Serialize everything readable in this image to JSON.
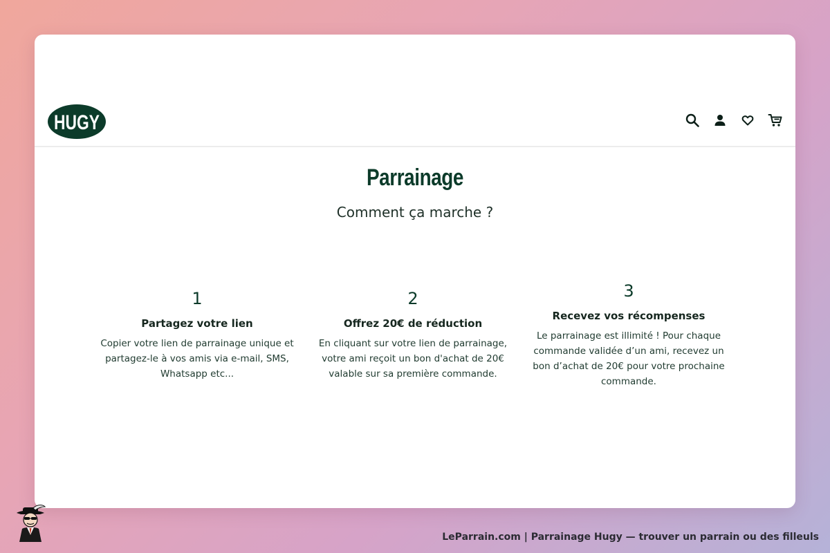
{
  "header": {
    "logo_text": "HUGY",
    "icons": [
      "search-icon",
      "account-icon",
      "wishlist-icon",
      "cart-icon"
    ]
  },
  "main": {
    "title": "Parrainage",
    "subtitle": "Comment ça marche ?",
    "steps": [
      {
        "number": "1",
        "title": "Partagez votre lien",
        "description": "Copier votre lien de parrainage unique et partagez-le à vos amis via e-mail, SMS, Whatsapp etc..."
      },
      {
        "number": "2",
        "title": "Offrez 20€ de réduction",
        "description": "En cliquant sur votre lien de parrainage, votre ami reçoit un bon d'achat de 20€ valable sur sa première commande."
      },
      {
        "number": "3",
        "title": "Recevez vos récompenses",
        "description": "Le parrainage est illimité ! Pour chaque commande validée d’un ami, recevez un bon d’achat de 20€ pour votre prochaine commande."
      }
    ]
  },
  "footer": {
    "caption": "LeParrain.com | Parrainage Hugy — trouver un parrain ou des filleuls"
  },
  "colors": {
    "brand": "#0c3b2a",
    "text": "#1f3a2f",
    "card": "#ffffff"
  }
}
